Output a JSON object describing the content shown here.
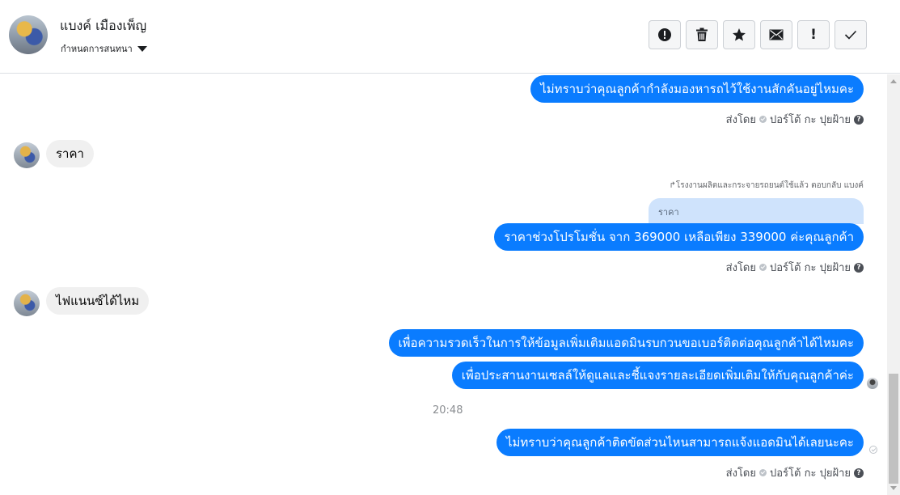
{
  "header": {
    "contact_name": "แบงค์ เมืองเพ็ญ",
    "assign_label": "กำหนดการสนทนา",
    "toolbar": [
      {
        "name": "spam-button",
        "icon": "alert-circle-icon"
      },
      {
        "name": "delete-button",
        "icon": "trash-icon"
      },
      {
        "name": "star-button",
        "icon": "star-icon"
      },
      {
        "name": "mark-unread-button",
        "icon": "envelope-icon"
      },
      {
        "name": "follow-up-button",
        "icon": "exclamation-icon",
        "glyph": "!"
      },
      {
        "name": "mark-done-button",
        "icon": "checkmark-icon"
      }
    ]
  },
  "messages": {
    "m1_text": "ไม่ทราบว่าคุณลูกค้ากำลังมองหารถไว้ใช้งานสักคันอยู่ไหมคะ",
    "m1_meta_prefix": "ส่งโดย",
    "m1_meta_sender": "ปอร์โต้ กะ ปุยฝ้าย",
    "m2_text": "ราคา",
    "reply_context": "โรงงานผลิตและกระจายรถยนต์ใช้แล้ว ตอบกลับ แบงค์",
    "quoted_text": "ราคา",
    "m3_text": "ราคาช่วงโปรโมชั่น จาก 369000 เหลือเพียง 339000 ค่ะคุณลูกค้า",
    "m3_meta_prefix": "ส่งโดย",
    "m3_meta_sender": "ปอร์โต้ กะ ปุยฝ้าย",
    "m4_text": "ไฟแนนซ์ได้ไหม",
    "m5_text": "เพื่อความรวดเร็วในการให้ข้อมูลเพิ่มเติมแอดมินรบกวนขอเบอร์ติดต่อคุณลูกค้าได้ไหมคะ",
    "m6_text": "เพื่อประสานงานเซลล์ให้ดูแลและชี้แจงรายละเอียดเพิ่มเติมให้กับคุณลูกค้าค่ะ",
    "timestamp": "20:48",
    "m7_text": "ไม่ทราบว่าคุณลูกค้าติดขัดส่วนไหนสามารถแจ้งแอดมินได้เลยนะคะ",
    "m7_meta_prefix": "ส่งโดย",
    "m7_meta_sender": "ปอร์โต้ กะ ปุยฝ้าย"
  },
  "colors": {
    "outgoing_bubble": "#0a7cff",
    "incoming_bubble": "#f0f0f0",
    "quote_bubble": "#cfe3fc"
  }
}
